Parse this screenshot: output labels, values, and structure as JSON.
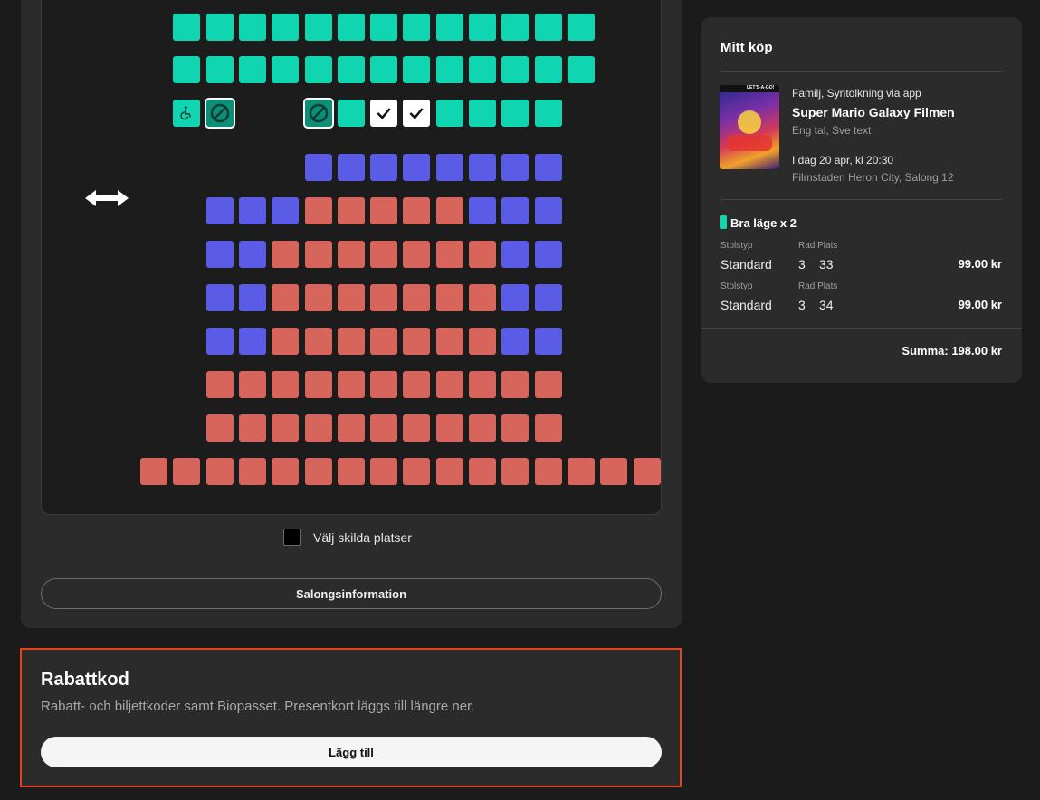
{
  "colors": {
    "available_standard": "#0fd6b1",
    "available_bra": "#5b5ce6",
    "occupied": "#d7655b",
    "selected": "#ffffff",
    "highlight_border": "#e8411e"
  },
  "seatmap": {
    "legend_icons": [
      "wheelchair-icon",
      "companion-seat-icon",
      "checkmark-icon",
      "double-arrow-icon"
    ],
    "separate_seats_label": "Välj skilda platser",
    "separate_seats_checked": false,
    "salong_button_label": "Salongsinformation"
  },
  "discount": {
    "title": "Rabattkod",
    "description": "Rabatt- och biljettkoder samt Biopasset. Presentkort läggs till längre ner.",
    "button_label": "Lägg till"
  },
  "summary": {
    "title": "Mitt köp",
    "movie": {
      "tags": "Familj, Syntolkning via app",
      "title": "Super Mario Galaxy Filmen",
      "language": "Eng tal, Sve text",
      "datetime": "I dag 20 apr, kl 20:30",
      "location": "Filmstaden Heron City, Salong 12",
      "poster_text": "LET'S-A-GO!"
    },
    "category": "Bra läge x 2",
    "col_labels": {
      "type": "Stolstyp",
      "row_seat": "Rad Plats"
    },
    "tickets": [
      {
        "type": "Standard",
        "row": "3",
        "seat": "33",
        "price": "99.00 kr"
      },
      {
        "type": "Standard",
        "row": "3",
        "seat": "34",
        "price": "99.00 kr"
      }
    ],
    "total": "Summa: 198.00 kr"
  }
}
